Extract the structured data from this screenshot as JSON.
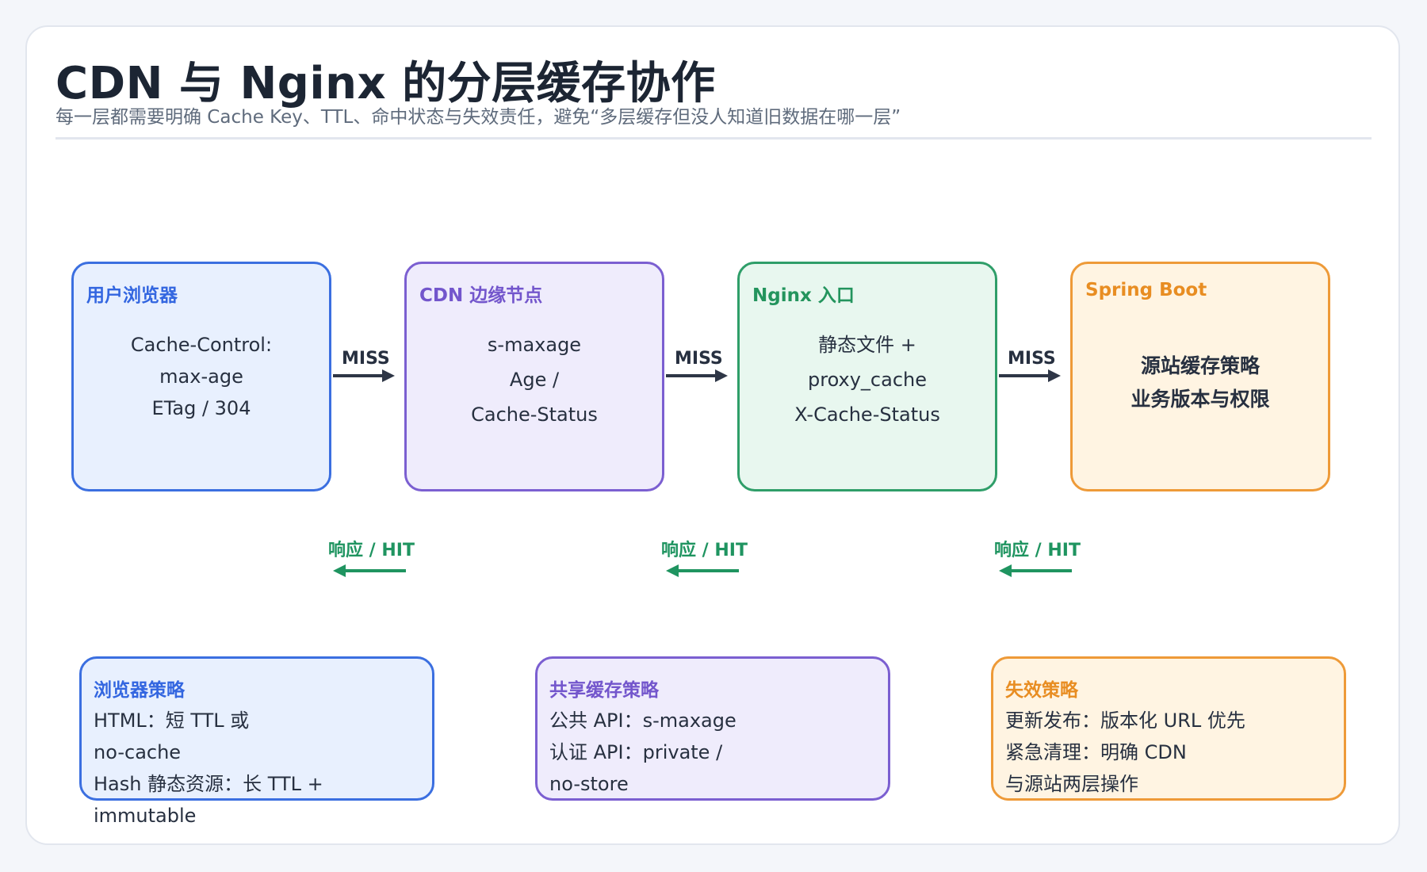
{
  "header": {
    "title": "CDN 与 Nginx 的分层缓存协作",
    "subtitle": "每一层都需要明确 Cache Key、TTL、命中状态与失效责任，避免“多层缓存但没人知道旧数据在哪一层”"
  },
  "nodes": [
    {
      "title": "用户浏览器",
      "lines": [
        "Cache-Control:",
        "max-age",
        "ETag / 304"
      ]
    },
    {
      "title": "CDN 边缘节点",
      "lines": [
        "s-maxage",
        "Age /",
        "Cache-Status"
      ]
    },
    {
      "title": "Nginx 入口",
      "lines": [
        "静态文件 +",
        "proxy_cache",
        "X-Cache-Status"
      ]
    },
    {
      "title": "Spring Boot",
      "lines": [
        "源站缓存策略",
        "业务版本与权限"
      ]
    }
  ],
  "flows": {
    "forward_label": "MISS",
    "return_label": "响应 / HIT"
  },
  "cards": [
    {
      "title": "浏览器策略",
      "lines": [
        "HTML：短 TTL 或",
        "no-cache",
        "Hash 静态资源：长 TTL +",
        "immutable"
      ]
    },
    {
      "title": "共享缓存策略",
      "lines": [
        "公共 API：s-maxage",
        "认证 API：private /",
        "no-store"
      ]
    },
    {
      "title": "失效策略",
      "lines": [
        "更新发布：版本化 URL 优先",
        "紧急清理：明确 CDN",
        "与源站两层操作"
      ]
    }
  ],
  "colors": {
    "browser": "#3b6fe0",
    "cdn": "#7b5fd1",
    "nginx": "#2f9e69",
    "spring": "#ee9a38",
    "miss_arrow": "#2e3646",
    "hit_arrow": "#1f9460"
  }
}
